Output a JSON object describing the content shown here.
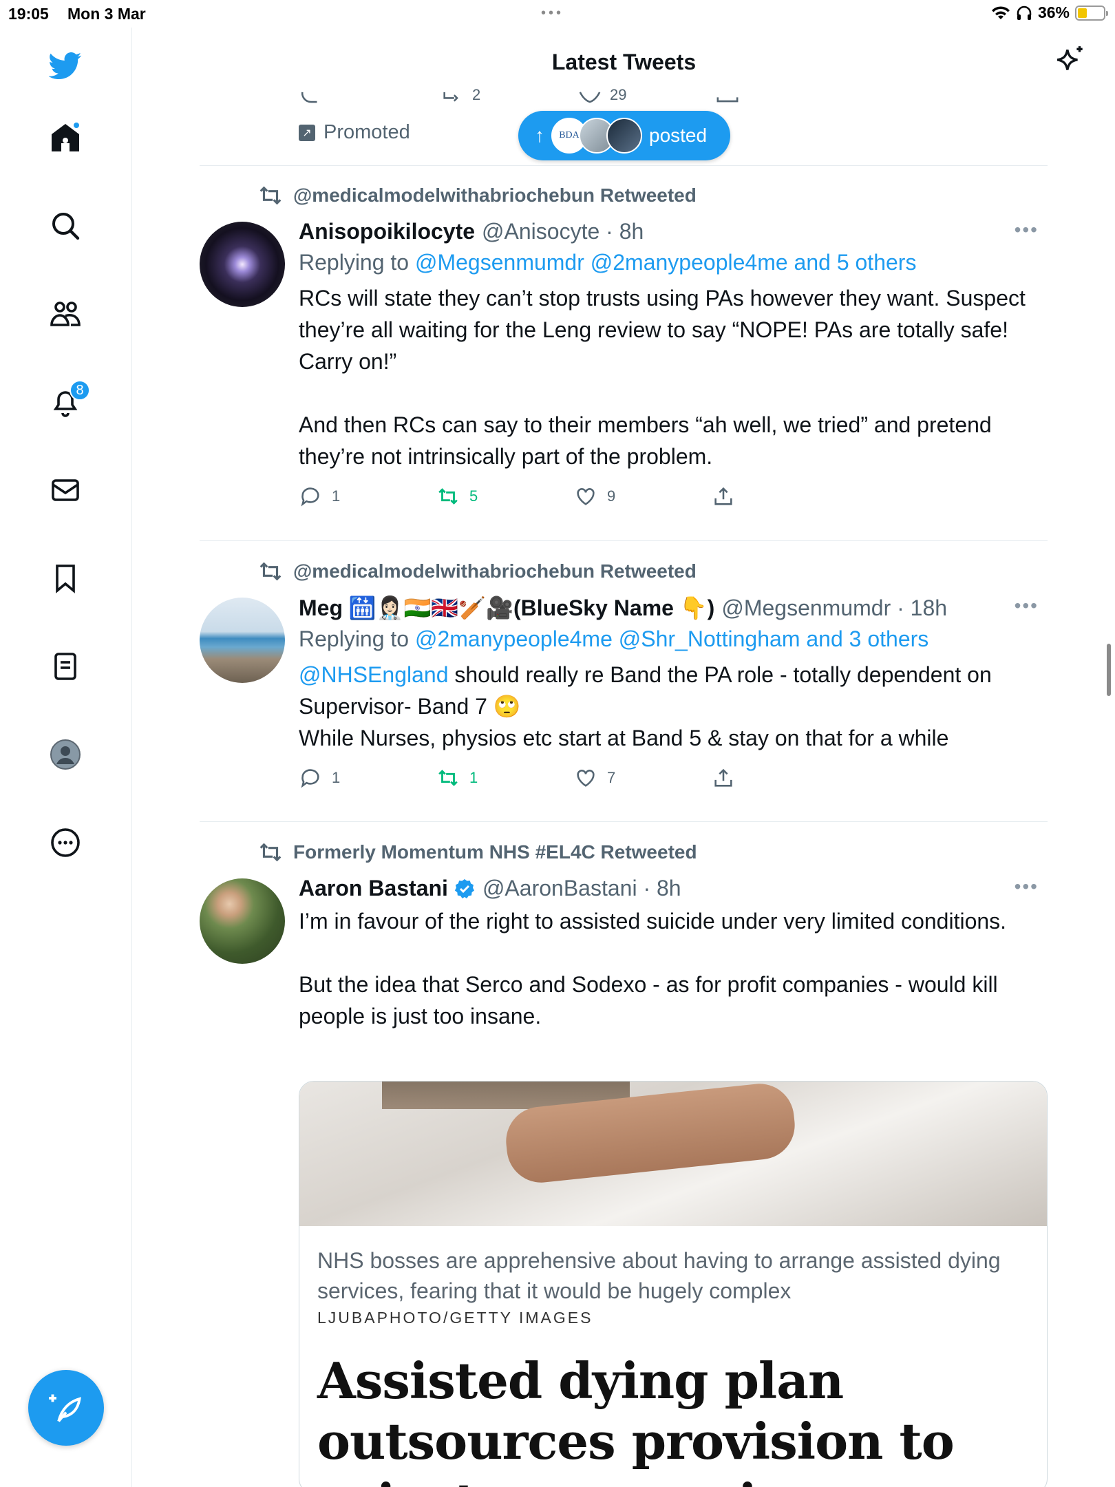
{
  "status_bar": {
    "time": "19:05",
    "date": "Mon 3 Mar",
    "battery": "36%",
    "battery_level": 0.36
  },
  "header": {
    "title": "Latest Tweets",
    "sparkle_icon": "sparkle-icon"
  },
  "sidebar": {
    "items": [
      {
        "icon": "twitter-bird-icon"
      },
      {
        "icon": "home-icon",
        "has_dot": true
      },
      {
        "icon": "search-icon"
      },
      {
        "icon": "communities-icon"
      },
      {
        "icon": "bell-icon",
        "badge": "8"
      },
      {
        "icon": "mail-icon"
      },
      {
        "icon": "bookmark-icon"
      },
      {
        "icon": "lists-icon"
      },
      {
        "icon": "profile-icon"
      },
      {
        "icon": "more-circle-icon"
      }
    ],
    "compose_icon": "compose-feather-icon"
  },
  "top_tweet": {
    "retweets": "2",
    "likes": "29",
    "promoted_label": "Promoted"
  },
  "new_posts_pill": {
    "label": "posted",
    "avatar1_text": "BDA"
  },
  "tweets": [
    {
      "retweeted_by": "@medicalmodelwithabriochebun Retweeted",
      "name": "Anisopoikilocyte",
      "handle": "@Anisocyte · 8h",
      "replying_prefix": "Replying to ",
      "replying_links": "@Megsenmumdr @2manypeople4me and 5 others",
      "body": "RCs will state they can’t stop trusts using PAs however they want. Suspect they’re all waiting for the Leng review to say “NOPE! PAs are totally safe! Carry on!”\n\nAnd then RCs can say to their members “ah well, we tried” and pretend they’re not intrinsically part of the problem.",
      "replies": "1",
      "retweets": "5",
      "likes": "9"
    },
    {
      "retweeted_by": "@medicalmodelwithabriochebun Retweeted",
      "name": "Meg 🛗👩🏻‍⚕️🇮🇳🇬🇧🏏🎥(BlueSky Name 👇)",
      "handle": "@Megsenmumdr · 18h",
      "replying_prefix": "Replying to ",
      "replying_links": "@2manypeople4me @Shr_Nottingham and 3 others",
      "body_link": "@NHSEngland",
      "body": " should really re Band the PA role - totally dependent on Supervisor- Band 7 🙄\nWhile Nurses, physios etc start at Band 5 & stay on that for a while",
      "replies": "1",
      "retweets": "1",
      "likes": "7"
    },
    {
      "retweeted_by": "Formerly Momentum NHS #EL4C Retweeted",
      "name": "Aaron Bastani",
      "verified": true,
      "handle": "@AaronBastani · 8h",
      "body": "I’m in favour of the right to assisted suicide under very limited conditions.\n\nBut the idea that Serco and Sodexo - as for profit companies - would kill people is just too insane.",
      "card": {
        "caption": "NHS bosses are apprehensive about having to arrange assisted dying services, fearing that it would be hugely complex",
        "credit": "LJUBAPHOTO/GETTY IMAGES",
        "headline": "Assisted dying plan outsources provision to private companies"
      }
    }
  ],
  "colors": {
    "accent": "#1d9bf0",
    "retweet_green": "#00ba7c",
    "secondary_text": "#536471"
  }
}
